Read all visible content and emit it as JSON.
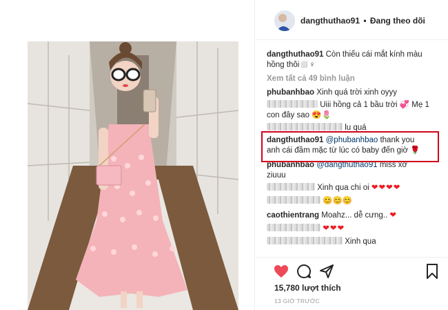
{
  "post": {
    "username": "dangthuthao91",
    "follow_status": "Đang theo dõi",
    "caption": "Còn thiếu cái mắt kính màu hồng thôi◻️♀",
    "view_all_comments": "Xem tất cả 49 bình luận",
    "likes": "15,780 lượt thích",
    "time": "13 GIỜ TRƯỚC"
  },
  "comments": [
    {
      "username": "phubanhbao",
      "text": "Xinh quá trời xinh oyyy"
    },
    {
      "username": "",
      "text": "Uiii hồng cả 1 bầu trời 💞 Mẹ 1"
    },
    {
      "username": "",
      "text": "con đây sao 😍🌷"
    },
    {
      "username": "",
      "text": "lu quá"
    },
    {
      "username": "dangthuthao91",
      "mention": "@phubanhbao",
      "text": " thank you"
    },
    {
      "username": "",
      "text": "anh cái đầm mặc từ lúc có baby đến giờ 🌹"
    },
    {
      "username": "phubanhbao",
      "mention": "@dangthuthao91",
      "text": " miss xờ"
    },
    {
      "username": "",
      "text": "ziuuu"
    },
    {
      "username": "",
      "text": "Xinh qua chi oi"
    },
    {
      "username": "",
      "text": "😊😊😊"
    },
    {
      "username": "caothientrang",
      "text": "Moahz... dễ cưng.."
    },
    {
      "username": "",
      "text": "Xinh qua"
    }
  ],
  "icons": {
    "like": "heart-filled-icon",
    "comment": "comment-bubble-icon",
    "share": "share-arrow-icon",
    "save": "bookmark-icon"
  },
  "colors": {
    "like_red": "#ed4956",
    "highlight_border": "#d0021b",
    "mention_blue": "#003569"
  }
}
